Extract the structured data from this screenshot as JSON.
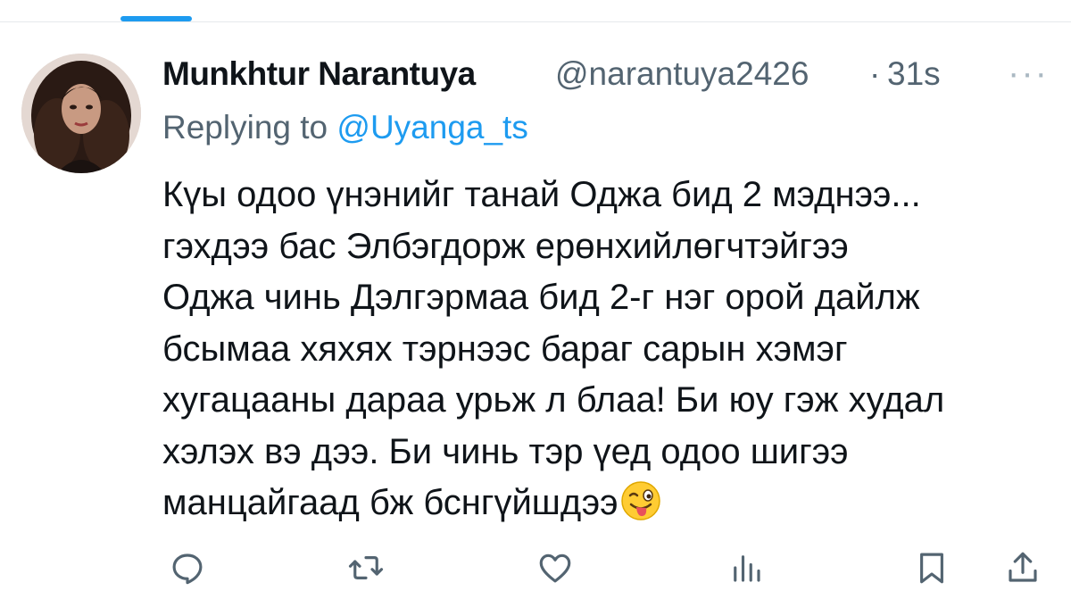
{
  "tweet": {
    "display_name": "Munkhtur Narantuya",
    "handle": "@narantuya2426",
    "separator": "·",
    "time": "31s",
    "more_label": "···",
    "replying_prefix": "Replying to",
    "replying_to": "@Uyanga_ts",
    "lines": [
      "Күы одоо үнэнийг танай Оджа бид 2 мэднээ...",
      "гэхдээ бас Элбэгдорж ерөнхийлөгчтэйгээ",
      "Оджа чинь Дэлгэрмаа бид 2-г нэг орой дайлж",
      "бсымаа хяхях тэрнээс бараг сарын хэмэг",
      "хугацааны дараа урьж л блаа! Би юу гэж худал",
      "хэлэх вэ дээ. Би чинь тэр үед одоо шигээ",
      "манцайгаад бж бснгүйшдээ"
    ],
    "emoji": "winking-face-with-tongue"
  },
  "actions": {
    "icons": [
      "reply-icon",
      "retweet-icon",
      "like-icon",
      "views-icon",
      "bookmark-icon",
      "share-icon"
    ]
  },
  "colors": {
    "accent": "#1d9bf0",
    "secondary_text": "#536471",
    "primary_text": "#0f1419"
  }
}
